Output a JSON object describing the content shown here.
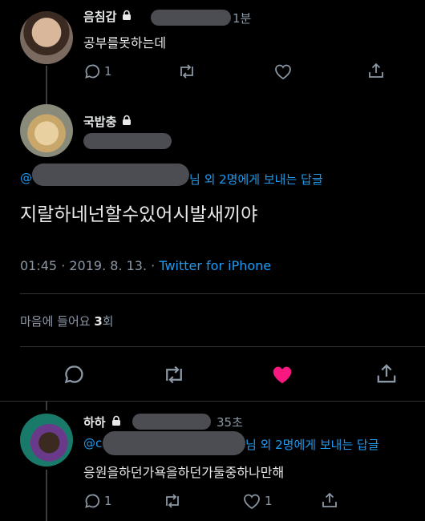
{
  "tweet1": {
    "name": "음침갑",
    "time": "1분",
    "text": "공부를못하는데",
    "reply_count": "1"
  },
  "main": {
    "name": "국밥충",
    "reply_prefix": "@",
    "reply_suffix": " 님 외 2명에게 보내는 답글",
    "text": "지랄하네넌할수있어시발새끼야",
    "time": "01:45",
    "date": "2019. 8. 13.",
    "source": "Twitter for iPhone",
    "likes_label": "마음에 들어요",
    "likes_count": "3",
    "likes_unit": "회"
  },
  "tweet3": {
    "name": "하하",
    "time": "35초",
    "reply_prefix": "@c",
    "reply_suffix": " 님 외 2명에게 보내는 답글",
    "text": "응원을하던가욕을하던가둘중하나만해",
    "reply_count": "1",
    "like_count": "1"
  },
  "colors": {
    "accent": "#1d9bf0",
    "like": "#f91880",
    "muted": "#8b98a5"
  }
}
